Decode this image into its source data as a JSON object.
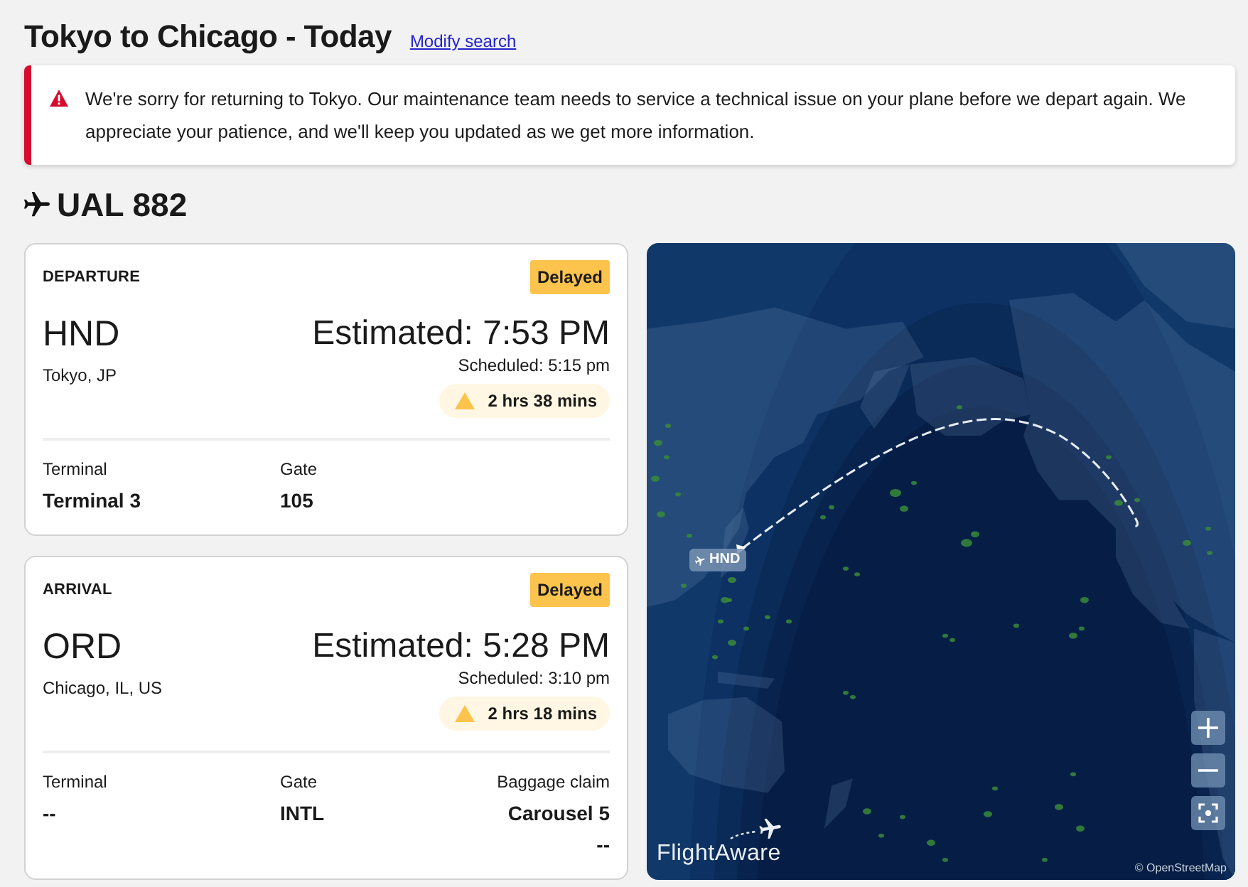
{
  "header": {
    "title": "Tokyo to Chicago - Today",
    "link": "Modify search"
  },
  "alert": {
    "kind": "error",
    "message": "We're sorry for returning to Tokyo. Our maintenance team needs to service a technical issue on your plane before we depart again. We appreciate your patience, and we'll keep you updated as we get more information."
  },
  "flight": {
    "number": "UAL 882"
  },
  "segments": [
    {
      "heading": "DEPARTURE",
      "status": "Delayed",
      "airport_code": "HND",
      "city": "Tokyo, JP",
      "estimated": "Estimated: 7:53 PM",
      "scheduled": "Scheduled: 5:15 pm",
      "delay": "2 hrs 38 mins",
      "details": [
        {
          "label": "Terminal",
          "value": "Terminal 3"
        },
        {
          "label": "Gate",
          "value": "105"
        }
      ]
    },
    {
      "heading": "ARRIVAL",
      "status": "Delayed",
      "airport_code": "ORD",
      "city": "Chicago, IL, US",
      "estimated": "Estimated: 5:28 PM",
      "scheduled": "Scheduled: 3:10 pm",
      "delay": "2 hrs 18 mins",
      "details": [
        {
          "label": "Terminal",
          "value": "--"
        },
        {
          "label": "Gate",
          "value": "INTL"
        },
        {
          "label": "Baggage claim",
          "value": "Carousel 5",
          "note": "--"
        }
      ]
    }
  ],
  "map": {
    "airport_label": "HND",
    "logo": "FlightAware",
    "attribution": "© OpenStreetMap"
  }
}
